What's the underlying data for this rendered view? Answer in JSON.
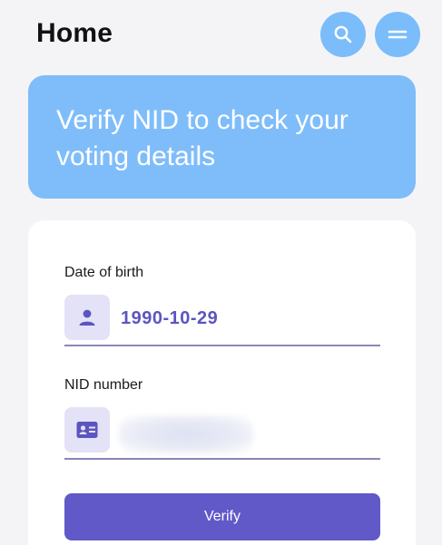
{
  "header": {
    "title": "Home",
    "search_icon": "search-icon",
    "menu_icon": "menu-icon"
  },
  "banner": {
    "text": "Verify NID to check your voting details",
    "color": "#7fbdfa"
  },
  "form": {
    "dob": {
      "label": "Date of birth",
      "value": "1990-10-29",
      "icon": "person-icon"
    },
    "nid": {
      "label": "NID number",
      "value": "",
      "icon": "id-card-icon",
      "redacted": true
    },
    "submit_label": "Verify"
  },
  "colors": {
    "accent": "#6159c8",
    "icon_bg": "#e4e2f7",
    "header_button": "#7bbcfb"
  }
}
